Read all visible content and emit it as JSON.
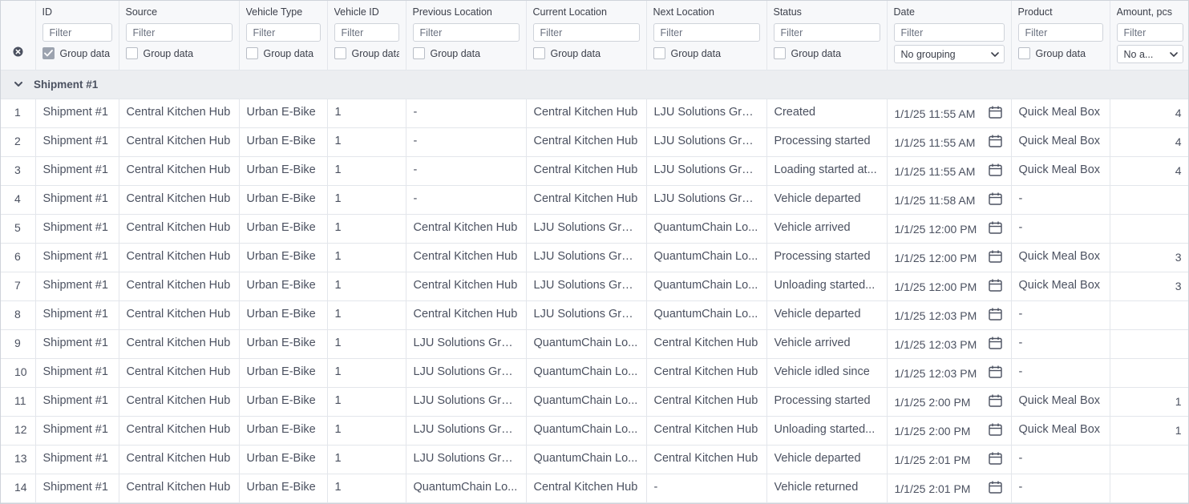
{
  "filter_placeholder": "Filter",
  "group_label": "Group data",
  "columns": [
    {
      "key": "id",
      "label": "ID",
      "grouped": true
    },
    {
      "key": "source",
      "label": "Source",
      "grouped": false
    },
    {
      "key": "vehicle_type",
      "label": "Vehicle Type",
      "grouped": false
    },
    {
      "key": "vehicle_id",
      "label": "Vehicle ID",
      "grouped": false
    },
    {
      "key": "previous_location",
      "label": "Previous Location",
      "grouped": false
    },
    {
      "key": "current_location",
      "label": "Current Location",
      "grouped": false
    },
    {
      "key": "next_location",
      "label": "Next Location",
      "grouped": false
    },
    {
      "key": "status",
      "label": "Status",
      "grouped": false
    },
    {
      "key": "date",
      "label": "Date",
      "dropdown": "No grouping"
    },
    {
      "key": "product",
      "label": "Product",
      "grouped": false
    },
    {
      "key": "amount",
      "label": "Amount, pcs",
      "dropdown": "No a..."
    }
  ],
  "group": {
    "title": "Shipment #1"
  },
  "rows": [
    {
      "n": "1",
      "id": "Shipment #1",
      "source": "Central Kitchen Hub",
      "vehicle_type": "Urban E-Bike",
      "vehicle_id": "1",
      "previous_location": "-",
      "current_location": "Central Kitchen Hub",
      "next_location": "LJU Solutions Group",
      "status": "Created",
      "date": "1/1/25 11:55 AM",
      "product": "Quick Meal Box",
      "amount": "4"
    },
    {
      "n": "2",
      "id": "Shipment #1",
      "source": "Central Kitchen Hub",
      "vehicle_type": "Urban E-Bike",
      "vehicle_id": "1",
      "previous_location": "-",
      "current_location": "Central Kitchen Hub",
      "next_location": "LJU Solutions Group",
      "status": "Processing started",
      "date": "1/1/25 11:55 AM",
      "product": "Quick Meal Box",
      "amount": "4"
    },
    {
      "n": "3",
      "id": "Shipment #1",
      "source": "Central Kitchen Hub",
      "vehicle_type": "Urban E-Bike",
      "vehicle_id": "1",
      "previous_location": "-",
      "current_location": "Central Kitchen Hub",
      "next_location": "LJU Solutions Group",
      "status": "Loading started at...",
      "date": "1/1/25 11:55 AM",
      "product": "Quick Meal Box",
      "amount": "4"
    },
    {
      "n": "4",
      "id": "Shipment #1",
      "source": "Central Kitchen Hub",
      "vehicle_type": "Urban E-Bike",
      "vehicle_id": "1",
      "previous_location": "-",
      "current_location": "Central Kitchen Hub",
      "next_location": "LJU Solutions Group",
      "status": "Vehicle departed",
      "date": "1/1/25 11:58 AM",
      "product": "-",
      "amount": ""
    },
    {
      "n": "5",
      "id": "Shipment #1",
      "source": "Central Kitchen Hub",
      "vehicle_type": "Urban E-Bike",
      "vehicle_id": "1",
      "previous_location": "Central Kitchen Hub",
      "current_location": "LJU Solutions Group",
      "next_location": "QuantumChain Lo...",
      "status": "Vehicle arrived",
      "date": "1/1/25 12:00 PM",
      "product": "-",
      "amount": ""
    },
    {
      "n": "6",
      "id": "Shipment #1",
      "source": "Central Kitchen Hub",
      "vehicle_type": "Urban E-Bike",
      "vehicle_id": "1",
      "previous_location": "Central Kitchen Hub",
      "current_location": "LJU Solutions Group",
      "next_location": "QuantumChain Lo...",
      "status": "Processing started",
      "date": "1/1/25 12:00 PM",
      "product": "Quick Meal Box",
      "amount": "3"
    },
    {
      "n": "7",
      "id": "Shipment #1",
      "source": "Central Kitchen Hub",
      "vehicle_type": "Urban E-Bike",
      "vehicle_id": "1",
      "previous_location": "Central Kitchen Hub",
      "current_location": "LJU Solutions Group",
      "next_location": "QuantumChain Lo...",
      "status": "Unloading started...",
      "date": "1/1/25 12:00 PM",
      "product": "Quick Meal Box",
      "amount": "3"
    },
    {
      "n": "8",
      "id": "Shipment #1",
      "source": "Central Kitchen Hub",
      "vehicle_type": "Urban E-Bike",
      "vehicle_id": "1",
      "previous_location": "Central Kitchen Hub",
      "current_location": "LJU Solutions Group",
      "next_location": "QuantumChain Lo...",
      "status": "Vehicle departed",
      "date": "1/1/25 12:03 PM",
      "product": "-",
      "amount": ""
    },
    {
      "n": "9",
      "id": "Shipment #1",
      "source": "Central Kitchen Hub",
      "vehicle_type": "Urban E-Bike",
      "vehicle_id": "1",
      "previous_location": "LJU Solutions Group",
      "current_location": "QuantumChain Lo...",
      "next_location": "Central Kitchen Hub",
      "status": "Vehicle arrived",
      "date": "1/1/25 12:03 PM",
      "product": "-",
      "amount": ""
    },
    {
      "n": "10",
      "id": "Shipment #1",
      "source": "Central Kitchen Hub",
      "vehicle_type": "Urban E-Bike",
      "vehicle_id": "1",
      "previous_location": "LJU Solutions Group",
      "current_location": "QuantumChain Lo...",
      "next_location": "Central Kitchen Hub",
      "status": "Vehicle idled since",
      "date": "1/1/25 12:03 PM",
      "product": "-",
      "amount": ""
    },
    {
      "n": "11",
      "id": "Shipment #1",
      "source": "Central Kitchen Hub",
      "vehicle_type": "Urban E-Bike",
      "vehicle_id": "1",
      "previous_location": "LJU Solutions Group",
      "current_location": "QuantumChain Lo...",
      "next_location": "Central Kitchen Hub",
      "status": "Processing started",
      "date": "1/1/25 2:00 PM",
      "product": "Quick Meal Box",
      "amount": "1"
    },
    {
      "n": "12",
      "id": "Shipment #1",
      "source": "Central Kitchen Hub",
      "vehicle_type": "Urban E-Bike",
      "vehicle_id": "1",
      "previous_location": "LJU Solutions Group",
      "current_location": "QuantumChain Lo...",
      "next_location": "Central Kitchen Hub",
      "status": "Unloading started...",
      "date": "1/1/25 2:00 PM",
      "product": "Quick Meal Box",
      "amount": "1"
    },
    {
      "n": "13",
      "id": "Shipment #1",
      "source": "Central Kitchen Hub",
      "vehicle_type": "Urban E-Bike",
      "vehicle_id": "1",
      "previous_location": "LJU Solutions Group",
      "current_location": "QuantumChain Lo...",
      "next_location": "Central Kitchen Hub",
      "status": "Vehicle departed",
      "date": "1/1/25 2:01 PM",
      "product": "-",
      "amount": ""
    },
    {
      "n": "14",
      "id": "Shipment #1",
      "source": "Central Kitchen Hub",
      "vehicle_type": "Urban E-Bike",
      "vehicle_id": "1",
      "previous_location": "QuantumChain Lo...",
      "current_location": "Central Kitchen Hub",
      "next_location": "-",
      "status": "Vehicle returned",
      "date": "1/1/25 2:01 PM",
      "product": "-",
      "amount": ""
    }
  ]
}
